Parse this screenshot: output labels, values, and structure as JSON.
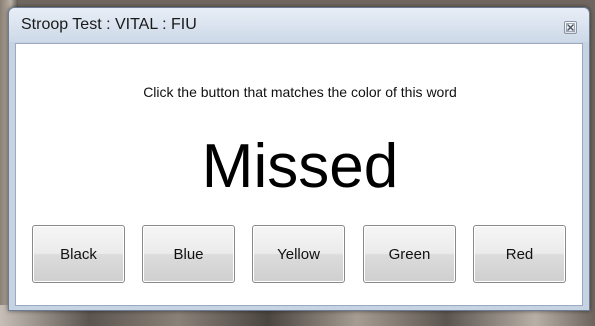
{
  "window": {
    "title": "Stroop Test : VITAL : FIU"
  },
  "main": {
    "instruction": "Click the button that matches the color of this word",
    "word": "Missed",
    "word_color": "#000000"
  },
  "buttons": [
    {
      "label": "Black"
    },
    {
      "label": "Blue"
    },
    {
      "label": "Yellow"
    },
    {
      "label": "Green"
    },
    {
      "label": "Red"
    }
  ]
}
